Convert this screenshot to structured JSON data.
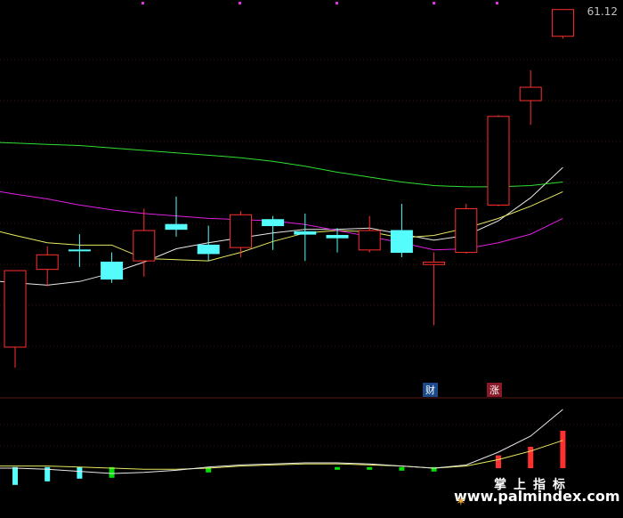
{
  "chart_data": {
    "type": "candlestick",
    "title": "",
    "price_label": "61.12",
    "candles": [
      {
        "o": 44.2,
        "h": 47.0,
        "l": 42.5,
        "c": 50.5,
        "color": "red"
      },
      {
        "o": 50.6,
        "h": 52.5,
        "l": 49.2,
        "c": 51.8,
        "color": "red"
      },
      {
        "o": 52.2,
        "h": 53.5,
        "l": 50.8,
        "c": 52.2,
        "color": "cyan"
      },
      {
        "o": 51.2,
        "h": 52.0,
        "l": 49.5,
        "c": 49.8,
        "color": "cyan"
      },
      {
        "o": 51.3,
        "h": 55.6,
        "l": 50.0,
        "c": 53.8,
        "color": "red"
      },
      {
        "o": 54.3,
        "h": 56.6,
        "l": 53.3,
        "c": 53.9,
        "color": "cyan"
      },
      {
        "o": 52.6,
        "h": 54.2,
        "l": 51.3,
        "c": 51.9,
        "color": "cyan"
      },
      {
        "o": 52.4,
        "h": 55.4,
        "l": 51.6,
        "c": 55.1,
        "color": "red"
      },
      {
        "o": 54.7,
        "h": 55.0,
        "l": 52.2,
        "c": 54.2,
        "color": "cyan"
      },
      {
        "o": 53.7,
        "h": 55.2,
        "l": 51.3,
        "c": 53.5,
        "color": "cyan"
      },
      {
        "o": 53.4,
        "h": 54.0,
        "l": 52.0,
        "c": 53.2,
        "color": "cyan"
      },
      {
        "o": 52.2,
        "h": 55.0,
        "l": 52.0,
        "c": 53.8,
        "color": "red"
      },
      {
        "o": 53.8,
        "h": 56.0,
        "l": 51.6,
        "c": 52.0,
        "color": "cyan"
      },
      {
        "o": 51.2,
        "h": 52.0,
        "l": 46.0,
        "c": 51.0,
        "color": "red"
      },
      {
        "o": 52.0,
        "h": 56.0,
        "l": 51.9,
        "c": 55.6,
        "color": "red"
      },
      {
        "o": 55.9,
        "h": 63.3,
        "l": 55.8,
        "c": 63.2,
        "color": "red"
      },
      {
        "o": 64.5,
        "h": 67.0,
        "l": 62.5,
        "c": 65.6,
        "color": "red"
      },
      {
        "o": 69.8,
        "h": 72.0,
        "l": 69.6,
        "c": 72.0,
        "color": "red"
      }
    ],
    "ma_lines": [
      {
        "color": "#e8e8e8",
        "values": [
          49.5,
          49.3,
          49.6,
          50.3,
          51.2,
          52.3,
          52.8,
          53.2,
          53.6,
          53.9,
          53.9,
          54.0,
          53.5,
          53.0,
          53.4,
          54.6,
          56.5,
          59.0
        ]
      },
      {
        "color": "#e8e860",
        "values": [
          53.4,
          52.8,
          52.6,
          52.6,
          51.5,
          51.4,
          51.3,
          52.0,
          52.9,
          53.6,
          53.8,
          53.7,
          53.2,
          53.4,
          54.0,
          54.8,
          55.8,
          57.0
        ]
      },
      {
        "color": "#e020e0",
        "values": [
          56.8,
          56.4,
          55.9,
          55.5,
          55.2,
          55.0,
          54.8,
          54.7,
          54.6,
          54.3,
          53.8,
          53.3,
          52.8,
          52.2,
          52.3,
          52.8,
          53.5,
          54.8
        ]
      },
      {
        "color": "#30e030",
        "values": [
          61.0,
          60.9,
          60.8,
          60.6,
          60.4,
          60.2,
          60.0,
          59.8,
          59.5,
          59.1,
          58.6,
          58.2,
          57.8,
          57.5,
          57.4,
          57.4,
          57.5,
          57.8
        ]
      }
    ],
    "tags": [
      {
        "index": 13,
        "text": "财"
      },
      {
        "index": 15,
        "text": "涨"
      }
    ],
    "indicator": {
      "bars": [
        {
          "v": 2.0,
          "color": "cyan"
        },
        {
          "v": 1.6,
          "color": "cyan"
        },
        {
          "v": 1.3,
          "color": "cyan"
        },
        {
          "v": 1.2,
          "color": "green"
        },
        {
          "v": 0.0,
          "color": "none"
        },
        {
          "v": 0.0,
          "color": "none"
        },
        {
          "v": 0.6,
          "color": "green"
        },
        {
          "v": 0.0,
          "color": "none"
        },
        {
          "v": 0.0,
          "color": "none"
        },
        {
          "v": 0.0,
          "color": "none"
        },
        {
          "v": 0.3,
          "color": "green"
        },
        {
          "v": 0.3,
          "color": "green"
        },
        {
          "v": 0.4,
          "color": "green"
        },
        {
          "v": 0.5,
          "color": "green"
        },
        {
          "v": 0.0,
          "color": "none"
        },
        {
          "v": 1.2,
          "color": "red"
        },
        {
          "v": 2.0,
          "color": "red"
        },
        {
          "v": 3.5,
          "color": "red"
        }
      ],
      "line_white": [
        0.0,
        -0.1,
        -0.3,
        -0.5,
        -0.4,
        -0.2,
        0.1,
        0.3,
        0.4,
        0.5,
        0.5,
        0.4,
        0.2,
        0.0,
        0.3,
        1.5,
        3.0,
        5.5
      ],
      "line_yellow": [
        0.2,
        0.2,
        0.1,
        0.0,
        -0.1,
        -0.1,
        0.0,
        0.2,
        0.3,
        0.4,
        0.4,
        0.3,
        0.2,
        0.0,
        0.2,
        0.8,
        1.6,
        2.6
      ]
    }
  },
  "tag_cai": "财",
  "tag_zhang": "涨",
  "brand_cn": "掌上指标",
  "brand_url": "www.palmindex.com"
}
